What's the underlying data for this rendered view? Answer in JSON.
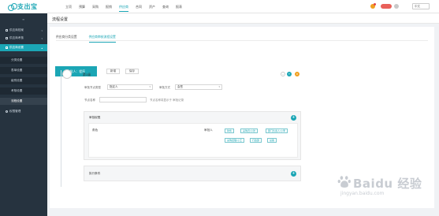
{
  "brand": {
    "logo_text": "支出宝"
  },
  "topnav": {
    "items": [
      {
        "label": "立项",
        "active": false
      },
      {
        "label": "预算",
        "active": false
      },
      {
        "label": "采购",
        "active": false
      },
      {
        "label": "报销",
        "active": false
      },
      {
        "label": "供应商",
        "active": true
      },
      {
        "label": "合同",
        "active": false
      },
      {
        "label": "资产",
        "active": false
      },
      {
        "label": "查询",
        "active": false
      },
      {
        "label": "报表",
        "active": false
      }
    ],
    "language": "中文",
    "accent_color": "#1ba6b5"
  },
  "sidebar": {
    "collapse_glyph": "≡",
    "items": [
      {
        "label": "供应商档案",
        "type": "group",
        "expanded": false,
        "icon": "doc-icon"
      },
      {
        "label": "供应商考核",
        "type": "group",
        "expanded": false,
        "icon": "doc-icon"
      },
      {
        "label": "供应商设置",
        "type": "group",
        "expanded": true,
        "icon": "settings-icon"
      },
      {
        "label": "分类设置",
        "type": "sub",
        "active": false
      },
      {
        "label": "表单设置",
        "type": "sub",
        "active": false
      },
      {
        "label": "级别设置",
        "type": "sub",
        "active": false
      },
      {
        "label": "考核设置",
        "type": "sub",
        "active": false
      },
      {
        "label": "流程设置",
        "type": "sub",
        "active": true
      },
      {
        "label": "权限管理",
        "type": "group",
        "expanded": false,
        "icon": "lock-icon"
      }
    ]
  },
  "page": {
    "title": "流程设置",
    "tabs": [
      {
        "label": "供应商分类设置",
        "active": false
      },
      {
        "label": "供应商审核流程设置",
        "active": true
      }
    ],
    "primary_button": "审批人：程序",
    "secondary_buttons": [
      "新增",
      "保存"
    ]
  },
  "node": {
    "title": "第1级",
    "actions": {
      "collapse": "–",
      "add": "+",
      "delete": "×"
    },
    "approver_type_label": "审批节点类型",
    "approver_type_value": "指定人",
    "approval_mode_label": "审批方式",
    "approval_mode_value": "会签",
    "node_name_label": "节点名称",
    "node_name_placeholder": "",
    "node_name_hint": "节点名称将显示于 审批记录",
    "approver_card": {
      "title": "审批权限",
      "condition_label": "角色",
      "approver_label": "审批人",
      "tags": [
        "财务",
        "采购员/小张",
        "部门负责人/小李",
        "采购经理/小王",
        "行政部",
        "总裁"
      ]
    },
    "condition_card": {
      "title": "执行条件"
    }
  },
  "watermark": {
    "brand": "Baidu 经验",
    "url": "jingyan.baidu.com"
  }
}
